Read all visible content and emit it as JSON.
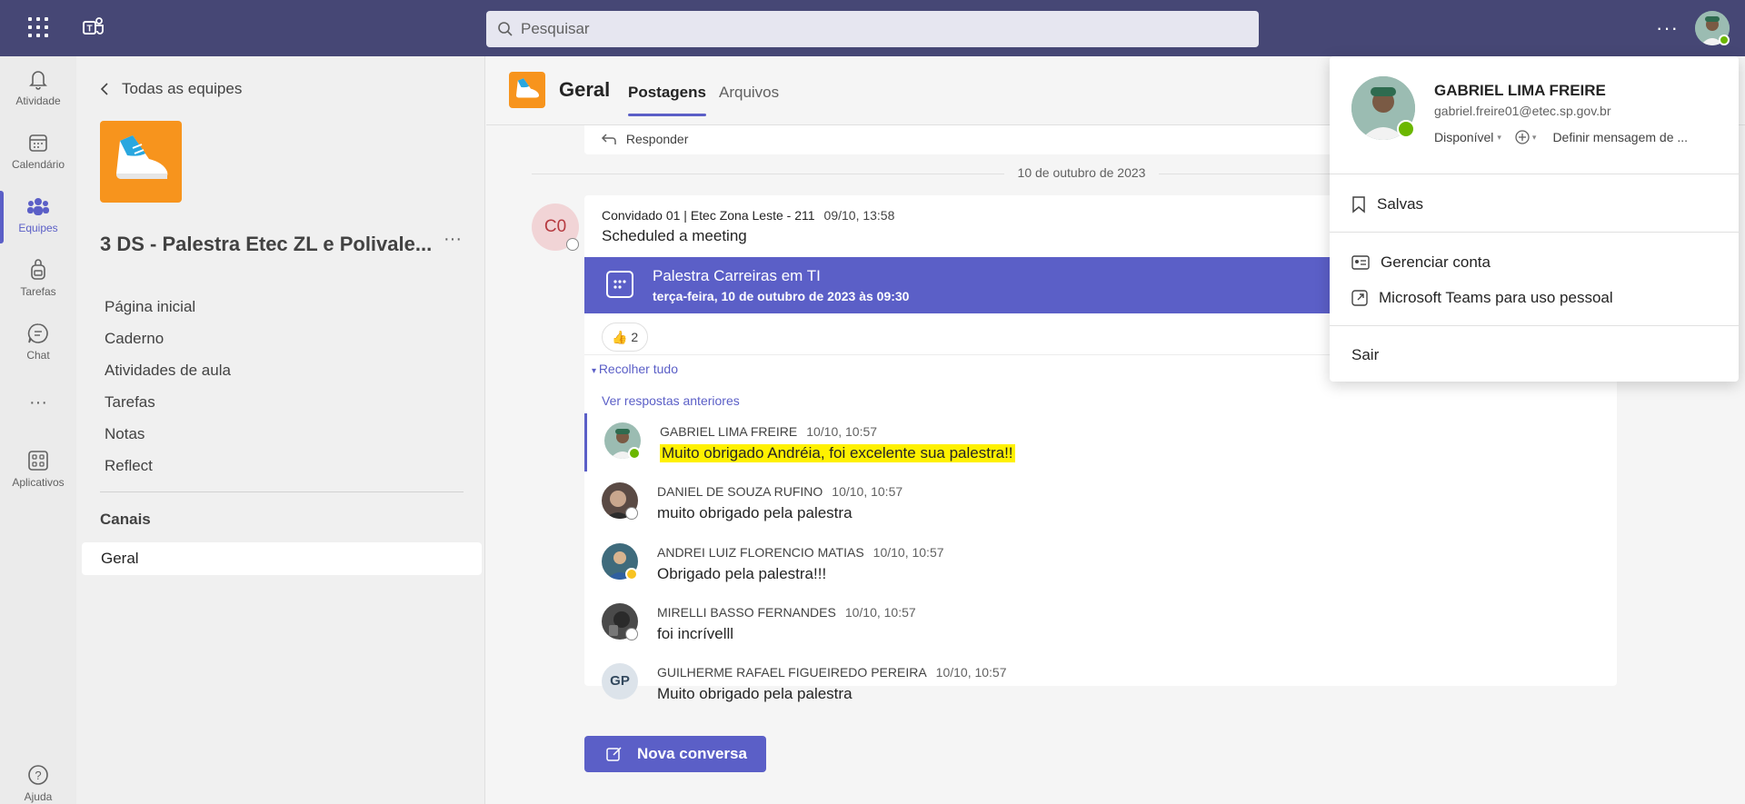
{
  "topbar": {
    "search_placeholder": "Pesquisar",
    "more_label": "···"
  },
  "rail": {
    "items": [
      {
        "label": "Atividade",
        "icon": "bell-icon"
      },
      {
        "label": "Calendário",
        "icon": "calendar-icon"
      },
      {
        "label": "Equipes",
        "icon": "teams-icon"
      },
      {
        "label": "Tarefas",
        "icon": "backpack-icon"
      },
      {
        "label": "Chat",
        "icon": "chat-icon"
      },
      {
        "label": "···",
        "icon": "more-icon"
      },
      {
        "label": "Aplicativos",
        "icon": "apps-icon"
      },
      {
        "label": "Ajuda",
        "icon": "help-icon"
      }
    ]
  },
  "team": {
    "back_label": "Todas as equipes",
    "name": "3 DS - Palestra Etec ZL e Polivale...",
    "more": "···",
    "nav": [
      "Página inicial",
      "Caderno",
      "Atividades de aula",
      "Tarefas",
      "Notas",
      "Reflect"
    ],
    "channels_heading": "Canais",
    "channel": "Geral"
  },
  "channel": {
    "title": "Geral",
    "tabs": [
      "Postagens",
      "Arquivos"
    ],
    "reply_label": "Responder",
    "date_separator": "10 de outubro de 2023",
    "post": {
      "avatar_initials": "C0",
      "author": "Convidado 01 | Etec Zona Leste - 211",
      "time": "09/10, 13:58",
      "text": "Scheduled a meeting",
      "meeting_title": "Palestra Carreiras em TI",
      "meeting_date": "terça-feira, 10 de outubro de 2023 às 09:30",
      "reaction_emoji": "👍",
      "reaction_count": "2",
      "collapse_label": "Recolher tudo",
      "earlier_label": "Ver respostas anteriores"
    },
    "replies": [
      {
        "author": "GABRIEL LIMA FREIRE",
        "time": "10/10, 10:57",
        "text": "Muito obrigado Andréia, foi excelente sua palestra!!"
      },
      {
        "author": "DANIEL DE SOUZA RUFINO",
        "time": "10/10, 10:57",
        "text": "muito obrigado pela palestra"
      },
      {
        "author": "ANDREI LUIZ FLORENCIO MATIAS",
        "time": "10/10, 10:57",
        "text": "Obrigado pela palestra!!!"
      },
      {
        "author": "MIRELLI BASSO FERNANDES",
        "time": "10/10, 10:57",
        "text": "foi incrívelll"
      },
      {
        "author": "GUILHERME RAFAEL FIGUEIREDO PEREIRA",
        "time": "10/10, 10:57",
        "text": "Muito obrigado pela palestra",
        "initials": "GP"
      }
    ],
    "new_conversation": "Nova conversa"
  },
  "profile": {
    "name": "GABRIEL LIMA FREIRE",
    "email": "gabriel.freire01@etec.sp.gov.br",
    "status": "Disponível",
    "set_message": "Definir mensagem de ...",
    "saved": "Salvas",
    "manage_account": "Gerenciar conta",
    "personal_teams": "Microsoft Teams para uso pessoal",
    "sign_out": "Sair"
  },
  "colors": {
    "topbar": "#464775",
    "accent": "#5b5fc7",
    "team_logo": "#f7941d",
    "highlight": "#fff100",
    "available": "#6bb700"
  }
}
